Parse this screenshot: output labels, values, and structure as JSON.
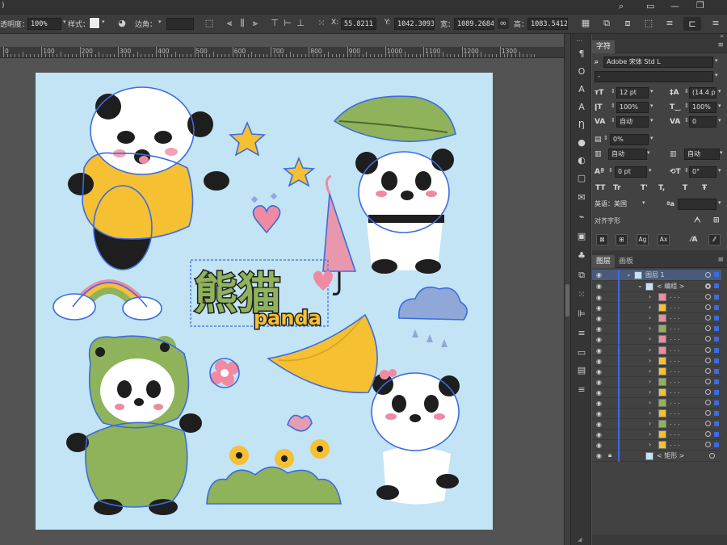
{
  "control_bar": {
    "opacity_label": "透明度：",
    "opacity_value": "100%",
    "style_label": "样式：",
    "corner_label": "边角：",
    "x_label": "X:",
    "x_value": "55.8211",
    "y_label": "Y:",
    "y_value": "1042.3093",
    "w_label": "宽：",
    "w_value": "1089.2684",
    "h_label": "高：",
    "h_value": "1083.5412"
  },
  "ruler": {
    "ticks": [
      {
        "label": "0"
      },
      {
        "label": "100"
      },
      {
        "label": "200"
      },
      {
        "label": "300"
      },
      {
        "label": "400"
      },
      {
        "label": "500"
      },
      {
        "label": "600"
      },
      {
        "label": "700"
      },
      {
        "label": "800"
      },
      {
        "label": "900"
      },
      {
        "label": "1000"
      },
      {
        "label": "1100"
      },
      {
        "label": "1200"
      },
      {
        "label": "1300"
      }
    ]
  },
  "artwork": {
    "title_chinese": "熊猫",
    "title_latin": "panda",
    "colors": {
      "artboard": "#c2e4f5",
      "selection": "#3d6be0",
      "yellow": "#f5c032",
      "green": "#8fb35a",
      "black": "#1e1e1e",
      "pink": "#f08aa0",
      "cloud": "#8fa8d8"
    }
  },
  "character_panel": {
    "tab_label": "字符",
    "font_name": "Adobe 宋体 Std L",
    "font_style": "-",
    "font_size": "12 pt",
    "leading": "(14.4 pt",
    "vertical_scale": "100%",
    "horizontal_scale": "100%",
    "kerning": "自动",
    "tracking": "0",
    "tsume": "0%",
    "aki_left": "自动",
    "aki_right": "自动",
    "baseline_shift": "0 pt",
    "rotation": "0°",
    "caps_buttons": [
      "TT",
      "Tr",
      "T'",
      "T,"
    ],
    "language": "英语：美国",
    "aa_label": "ªa",
    "align_glyph_label": "对齐字形"
  },
  "layers_panel": {
    "tabs": [
      {
        "label": "图层"
      },
      {
        "label": "画板"
      }
    ],
    "layer_name": "图层 1",
    "group_name": "< 编组 >",
    "sub_items": [
      {
        "name": ". . .",
        "thumb": "#f08aa0"
      },
      {
        "name": ". . .",
        "thumb": "#f5c032"
      },
      {
        "name": ". . .",
        "thumb": "#f08aa0"
      },
      {
        "name": ". . .",
        "thumb": "#8fb35a"
      },
      {
        "name": ". . .",
        "thumb": "#f08aa0"
      },
      {
        "name": ". . .",
        "thumb": "#f08aa0"
      },
      {
        "name": ". . .",
        "thumb": "#f5c032"
      },
      {
        "name": ". . .",
        "thumb": "#f5c032"
      },
      {
        "name": ". . .",
        "thumb": "#8fb35a"
      },
      {
        "name": ". . .",
        "thumb": "#f5c032"
      },
      {
        "name": ". . .",
        "thumb": "#8fb35a"
      },
      {
        "name": ". . .",
        "thumb": "#f5c032"
      },
      {
        "name": ". . .",
        "thumb": "#8fb35a"
      },
      {
        "name": ". . .",
        "thumb": "#f5c032"
      },
      {
        "name": ". . .",
        "thumb": "#f5c032"
      }
    ],
    "rect_name": "< 矩形 >"
  }
}
